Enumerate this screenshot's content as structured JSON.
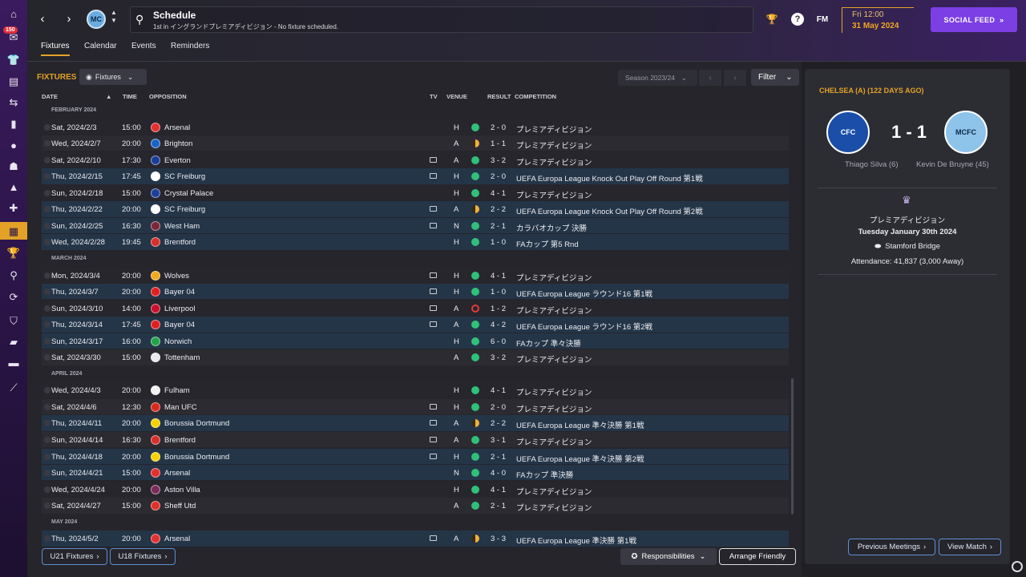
{
  "sidebar": {
    "badge": "150",
    "icons": [
      "home-icon",
      "inbox-icon",
      "squad-icon",
      "tactics-icon",
      "staff-icon",
      "team-report-icon",
      "medical-icon",
      "scouting-icon",
      "training-icon",
      "development-icon",
      "transfers-icon",
      "schedule-icon",
      "competitions-icon",
      "search-icon",
      "refresh-icon",
      "club-vision-icon",
      "finances-icon",
      "dev-centre-icon",
      "fm-icon"
    ]
  },
  "header": {
    "title": "Schedule",
    "subtitle": "1st in イングランドプレミアディビジョン - No fixture scheduled.",
    "fm_label": "FM",
    "date_day": "Fri 12:00",
    "date_full": "31 May 2024",
    "social_feed": "SOCIAL FEED"
  },
  "tabs": [
    "Fixtures",
    "Calendar",
    "Events",
    "Reminders"
  ],
  "fixtures": {
    "title": "FIXTURES",
    "view_dropdown": "Fixtures",
    "season": "Season 2023/24",
    "filter": "Filter",
    "columns": {
      "date": "DATE",
      "time": "TIME",
      "opposition": "OPPOSITION",
      "tv": "TV",
      "venue": "VENUE",
      "result": "RESULT",
      "competition": "COMPETITION"
    },
    "rows": [
      {
        "type": "month",
        "label": "FEBRUARY 2024"
      },
      {
        "type": "match",
        "date": "Sat, 2024/2/3",
        "time": "15:00",
        "opp": "Arsenal",
        "crest": "#e2312f",
        "tv": false,
        "venue": "H",
        "outcome": "W",
        "result": "2 - 0",
        "comp": "プレミアディビジョン"
      },
      {
        "type": "match",
        "date": "Wed, 2024/2/7",
        "time": "20:00",
        "opp": "Brighton",
        "crest": "#1a64c8",
        "tv": false,
        "venue": "A",
        "outcome": "D",
        "result": "1 - 1",
        "comp": "プレミアディビジョン"
      },
      {
        "type": "match",
        "date": "Sat, 2024/2/10",
        "time": "17:30",
        "opp": "Everton",
        "crest": "#1a3d9a",
        "tv": true,
        "venue": "A",
        "outcome": "W",
        "result": "3 - 2",
        "comp": "プレミアディビジョン"
      },
      {
        "type": "match",
        "hl": true,
        "date": "Thu, 2024/2/15",
        "time": "17:45",
        "opp": "SC Freiburg",
        "crest": "#ffffff",
        "tv": true,
        "venue": "H",
        "outcome": "W",
        "result": "2 - 0",
        "comp": "UEFA Europa League Knock Out Play Off Round 第1戦"
      },
      {
        "type": "match",
        "date": "Sun, 2024/2/18",
        "time": "15:00",
        "opp": "Crystal Palace",
        "crest": "#1e3f9c",
        "tv": false,
        "venue": "H",
        "outcome": "W",
        "result": "4 - 1",
        "comp": "プレミアディビジョン"
      },
      {
        "type": "match",
        "hl": true,
        "date": "Thu, 2024/2/22",
        "time": "20:00",
        "opp": "SC Freiburg",
        "crest": "#ffffff",
        "tv": true,
        "venue": "A",
        "outcome": "D",
        "result": "2 - 2",
        "comp": "UEFA Europa League Knock Out Play Off Round 第2戦"
      },
      {
        "type": "match",
        "hl": true,
        "date": "Sun, 2024/2/25",
        "time": "16:30",
        "opp": "West Ham",
        "crest": "#7a2636",
        "tv": true,
        "venue": "N",
        "outcome": "W",
        "result": "2 - 1",
        "comp": "カラバオカップ 決勝"
      },
      {
        "type": "match",
        "hl": true,
        "date": "Wed, 2024/2/28",
        "time": "19:45",
        "opp": "Brentford",
        "crest": "#d6312c",
        "tv": false,
        "venue": "H",
        "outcome": "W",
        "result": "1 - 0",
        "comp": "FAカップ 第5 Rnd"
      },
      {
        "type": "month",
        "label": "MARCH 2024"
      },
      {
        "type": "match",
        "date": "Mon, 2024/3/4",
        "time": "20:00",
        "opp": "Wolves",
        "crest": "#f0a81e",
        "tv": true,
        "venue": "H",
        "outcome": "W",
        "result": "4 - 1",
        "comp": "プレミアディビジョン"
      },
      {
        "type": "match",
        "hl": true,
        "date": "Thu, 2024/3/7",
        "time": "20:00",
        "opp": "Bayer 04",
        "crest": "#e02020",
        "tv": true,
        "venue": "H",
        "outcome": "W",
        "result": "1 - 0",
        "comp": "UEFA Europa League ラウンド16 第1戦"
      },
      {
        "type": "match",
        "date": "Sun, 2024/3/10",
        "time": "14:00",
        "opp": "Liverpool",
        "crest": "#c8102e",
        "tv": true,
        "venue": "A",
        "outcome": "L",
        "result": "1 - 2",
        "comp": "プレミアディビジョン"
      },
      {
        "type": "match",
        "hl": true,
        "date": "Thu, 2024/3/14",
        "time": "17:45",
        "opp": "Bayer 04",
        "crest": "#e02020",
        "tv": true,
        "venue": "A",
        "outcome": "W",
        "result": "4 - 2",
        "comp": "UEFA Europa League ラウンド16 第2戦"
      },
      {
        "type": "match",
        "hl": true,
        "date": "Sun, 2024/3/17",
        "time": "16:00",
        "opp": "Norwich",
        "crest": "#21a34a",
        "tv": false,
        "venue": "H",
        "outcome": "W",
        "result": "6 - 0",
        "comp": "FAカップ 準々決勝"
      },
      {
        "type": "match",
        "date": "Sat, 2024/3/30",
        "time": "15:00",
        "opp": "Tottenham",
        "crest": "#e8e8ee",
        "tv": false,
        "venue": "A",
        "outcome": "W",
        "result": "3 - 2",
        "comp": "プレミアディビジョン"
      },
      {
        "type": "month",
        "label": "APRIL 2024"
      },
      {
        "type": "match",
        "date": "Wed, 2024/4/3",
        "time": "20:00",
        "opp": "Fulham",
        "crest": "#f2f2f2",
        "tv": false,
        "venue": "H",
        "outcome": "W",
        "result": "4 - 1",
        "comp": "プレミアディビジョン"
      },
      {
        "type": "match",
        "date": "Sat, 2024/4/6",
        "time": "12:30",
        "opp": "Man UFC",
        "crest": "#da291c",
        "tv": true,
        "venue": "H",
        "outcome": "W",
        "result": "2 - 0",
        "comp": "プレミアディビジョン"
      },
      {
        "type": "match",
        "hl": true,
        "date": "Thu, 2024/4/11",
        "time": "20:00",
        "opp": "Borussia Dortmund",
        "crest": "#f5d300",
        "tv": true,
        "venue": "A",
        "outcome": "D",
        "result": "2 - 2",
        "comp": "UEFA Europa League 準々決勝 第1戦"
      },
      {
        "type": "match",
        "date": "Sun, 2024/4/14",
        "time": "16:30",
        "opp": "Brentford",
        "crest": "#d6312c",
        "tv": true,
        "venue": "A",
        "outcome": "W",
        "result": "3 - 1",
        "comp": "プレミアディビジョン"
      },
      {
        "type": "match",
        "hl": true,
        "date": "Thu, 2024/4/18",
        "time": "20:00",
        "opp": "Borussia Dortmund",
        "crest": "#f5d300",
        "tv": true,
        "venue": "H",
        "outcome": "W",
        "result": "2 - 1",
        "comp": "UEFA Europa League 準々決勝 第2戦"
      },
      {
        "type": "match",
        "hl": true,
        "date": "Sun, 2024/4/21",
        "time": "15:00",
        "opp": "Arsenal",
        "crest": "#e2312f",
        "tv": false,
        "venue": "N",
        "outcome": "W",
        "result": "4 - 0",
        "comp": "FAカップ 準決勝"
      },
      {
        "type": "match",
        "date": "Wed, 2024/4/24",
        "time": "20:00",
        "opp": "Aston Villa",
        "crest": "#7a2c5c",
        "tv": false,
        "venue": "H",
        "outcome": "W",
        "result": "4 - 1",
        "comp": "プレミアディビジョン"
      },
      {
        "type": "match",
        "date": "Sat, 2024/4/27",
        "time": "15:00",
        "opp": "Sheff Utd",
        "crest": "#e0302a",
        "tv": false,
        "venue": "A",
        "outcome": "W",
        "result": "2 - 1",
        "comp": "プレミアディビジョン"
      },
      {
        "type": "month",
        "label": "MAY 2024"
      },
      {
        "type": "match",
        "hl": true,
        "date": "Thu, 2024/5/2",
        "time": "20:00",
        "opp": "Arsenal",
        "crest": "#e2312f",
        "tv": true,
        "venue": "A",
        "outcome": "D",
        "result": "3 - 3",
        "comp": "UEFA Europa League 準決勝 第1戦"
      }
    ],
    "u21_btn": "U21 Fixtures",
    "u18_btn": "U18 Fixtures",
    "responsibilities_btn": "Responsibilities",
    "arrange_btn": "Arrange Friendly"
  },
  "panel": {
    "title": "CHELSEA (A) (122 DAYS AGO)",
    "score": "1 - 1",
    "home_scorer": "Thiago Silva (6)",
    "away_scorer": "Kevin De Bruyne (45)",
    "competition": "プレミアディビジョン",
    "date": "Tuesday January 30th 2024",
    "stadium": "Stamford Bridge",
    "attendance": "Attendance: 41,837 (3,000 Away)",
    "prev_btn": "Previous Meetings",
    "view_btn": "View Match"
  }
}
